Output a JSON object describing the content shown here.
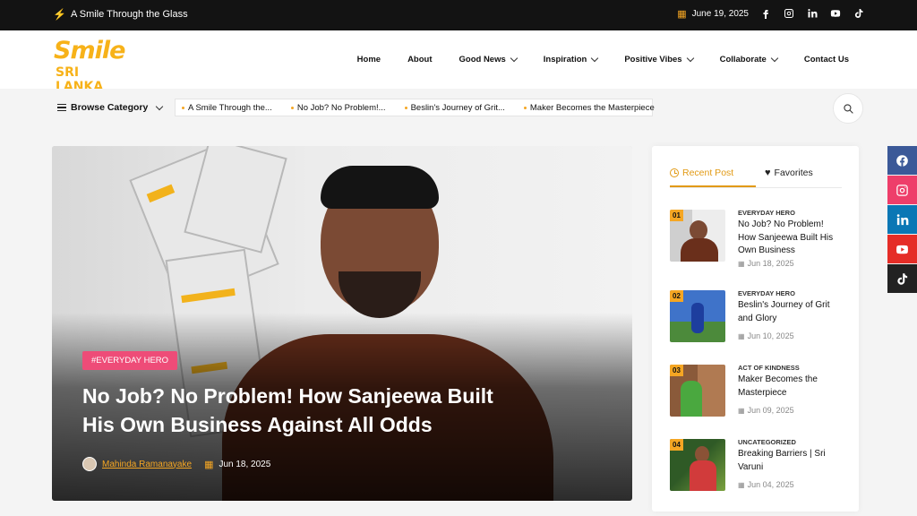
{
  "topbar": {
    "tagline": "A Smile Through the Glass",
    "date": "June 19, 2025",
    "social": [
      "facebook-icon",
      "instagram-icon",
      "linkedin-icon",
      "youtube-icon",
      "tiktok-icon"
    ]
  },
  "logo": {
    "line1": "Smile",
    "line2": "SRI LANKA"
  },
  "nav": {
    "items": [
      {
        "label": "Home"
      },
      {
        "label": "About"
      },
      {
        "label": "Good News"
      },
      {
        "label": "Inspiration"
      },
      {
        "label": "Positive Vibes"
      },
      {
        "label": "Collaborate"
      },
      {
        "label": "Contact Us"
      }
    ]
  },
  "category_bar": {
    "browse_label": "Browse Category",
    "ticker": [
      "A Smile Through the...",
      "No Job? No Problem!...",
      "Beslin's Journey of Grit...",
      "Maker Becomes the Masterpiece"
    ]
  },
  "hero": {
    "tag": "#EVERYDAY HERO",
    "title": "No Job? No Problem! How Sanjeewa Built His Own Business Against All Odds",
    "author": "Mahinda Ramanayake",
    "date": "Jun 18, 2025"
  },
  "sidebar": {
    "tab_recent": "Recent Post",
    "tab_favorites": "Favorites",
    "posts": [
      {
        "num": "01",
        "category": "EVERYDAY HERO",
        "title": "No Job? No Problem! How Sanjeewa Built His Own Business",
        "date": "Jun 18, 2025"
      },
      {
        "num": "02",
        "category": "EVERYDAY HERO",
        "title": "Beslin's Journey of Grit and Glory",
        "date": "Jun 10, 2025"
      },
      {
        "num": "03",
        "category": "ACT OF KINDNESS",
        "title": "Maker Becomes the Masterpiece",
        "date": "Jun 09, 2025"
      },
      {
        "num": "04",
        "category": "UNCATEGORIZED",
        "title": "Breaking Barriers | Sri Varuni",
        "date": "Jun 04, 2025"
      }
    ]
  },
  "floating_social": {
    "items": [
      {
        "icon": "facebook-icon",
        "color": "#3b5998"
      },
      {
        "icon": "instagram-icon",
        "color": "#ee3e6a"
      },
      {
        "icon": "linkedin-icon",
        "color": "#0a77b5"
      },
      {
        "icon": "youtube-icon",
        "color": "#e52d27"
      },
      {
        "icon": "tiktok-icon",
        "color": "#222222"
      }
    ]
  },
  "colors": {
    "accent": "#f5a623",
    "tag": "#ee4c78",
    "topbar": "#131313"
  }
}
